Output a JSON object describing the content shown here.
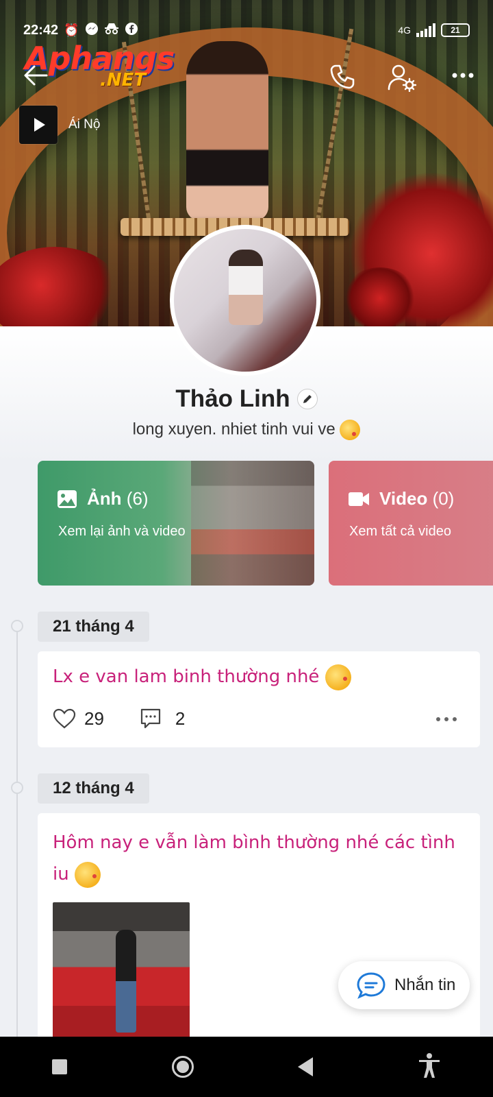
{
  "status_bar": {
    "time": "22:42",
    "network": "4G",
    "battery": "21"
  },
  "watermark": {
    "line1": "Aphangs",
    "line2": ".NET"
  },
  "music": {
    "title": "Ái Nộ"
  },
  "profile": {
    "name": "Thảo Linh",
    "bio": "long xuyen. nhiet tinh vui ve"
  },
  "cards": {
    "photos": {
      "label": "Ảnh",
      "count": "(6)",
      "subtitle": "Xem lại ảnh và video"
    },
    "videos": {
      "label": "Video",
      "count": "(0)",
      "subtitle": "Xem tất cả video"
    }
  },
  "posts": [
    {
      "date": "21 tháng 4",
      "text": "Lx e van lam binh thường nhé",
      "likes": "29",
      "comments": "2"
    },
    {
      "date": "12 tháng 4",
      "text_line1": "Hôm nay e vẫn làm bình thường  nhé  các tình",
      "text_line2": "iu"
    }
  ],
  "chat_button": {
    "label": "Nhắn tin"
  },
  "icons": {
    "accent_pink": "#c8217a",
    "photos_card_color": "#3f9a69",
    "videos_card_color": "#db6f7a"
  }
}
